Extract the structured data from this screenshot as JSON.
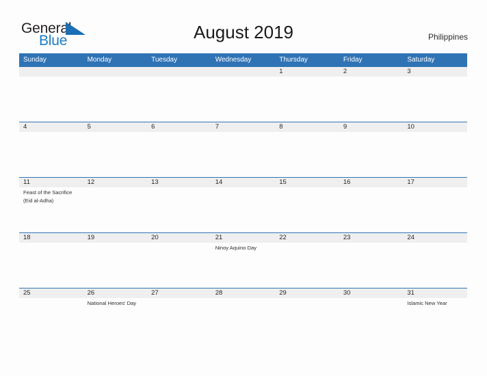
{
  "brand": {
    "name_dark": "General",
    "name_blue": "Blue",
    "flag_icon": "blue-triangle-flag-icon",
    "dark_color": "#231f20",
    "blue_color": "#1a7bc4"
  },
  "header": {
    "title": "August 2019",
    "country": "Philippines"
  },
  "theme": {
    "header_blue": "#2f73b5",
    "date_band_gray": "#efefef",
    "page_background": "#fdfdfd",
    "text_color": "#262626"
  },
  "calendar": {
    "weekdays": [
      "Sunday",
      "Monday",
      "Tuesday",
      "Wednesday",
      "Thursday",
      "Friday",
      "Saturday"
    ],
    "weeks": [
      {
        "days": [
          {
            "date": "",
            "event": ""
          },
          {
            "date": "",
            "event": ""
          },
          {
            "date": "",
            "event": ""
          },
          {
            "date": "",
            "event": ""
          },
          {
            "date": "1",
            "event": ""
          },
          {
            "date": "2",
            "event": ""
          },
          {
            "date": "3",
            "event": ""
          }
        ]
      },
      {
        "days": [
          {
            "date": "4",
            "event": ""
          },
          {
            "date": "5",
            "event": ""
          },
          {
            "date": "6",
            "event": ""
          },
          {
            "date": "7",
            "event": ""
          },
          {
            "date": "8",
            "event": ""
          },
          {
            "date": "9",
            "event": ""
          },
          {
            "date": "10",
            "event": ""
          }
        ]
      },
      {
        "days": [
          {
            "date": "11",
            "event": "Feast of the Sacrifice (Eid al-Adha)"
          },
          {
            "date": "12",
            "event": ""
          },
          {
            "date": "13",
            "event": ""
          },
          {
            "date": "14",
            "event": ""
          },
          {
            "date": "15",
            "event": ""
          },
          {
            "date": "16",
            "event": ""
          },
          {
            "date": "17",
            "event": ""
          }
        ]
      },
      {
        "days": [
          {
            "date": "18",
            "event": ""
          },
          {
            "date": "19",
            "event": ""
          },
          {
            "date": "20",
            "event": ""
          },
          {
            "date": "21",
            "event": "Ninoy Aquino Day"
          },
          {
            "date": "22",
            "event": ""
          },
          {
            "date": "23",
            "event": ""
          },
          {
            "date": "24",
            "event": ""
          }
        ]
      },
      {
        "days": [
          {
            "date": "25",
            "event": ""
          },
          {
            "date": "26",
            "event": "National Heroes' Day"
          },
          {
            "date": "27",
            "event": ""
          },
          {
            "date": "28",
            "event": ""
          },
          {
            "date": "29",
            "event": ""
          },
          {
            "date": "30",
            "event": ""
          },
          {
            "date": "31",
            "event": "Islamic New Year"
          }
        ]
      }
    ]
  }
}
